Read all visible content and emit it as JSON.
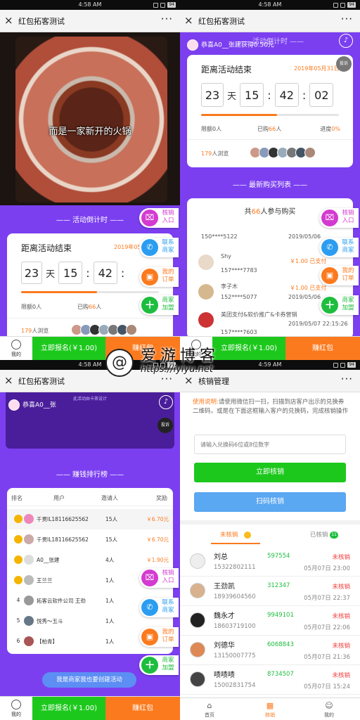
{
  "status": {
    "time1": "4:58 AM",
    "time2": "4:58 AM",
    "time3": "4:58 AM",
    "time4": "4:59 AM",
    "battery": "94"
  },
  "nav": {
    "close": "×",
    "title": "红包拓客测试",
    "more": "···",
    "title4": "核销管理"
  },
  "video": {
    "caption": "而是一家新开的火锅"
  },
  "countdown": {
    "header": "活动倒计时",
    "title": "距离活动结束",
    "date": "2019年05月31日",
    "days": "23",
    "day_unit": "天",
    "hours": "15",
    "minutes": "42",
    "seconds": "02",
    "progress": 0.55,
    "limit": "限额0人",
    "sold_prefix": "已购",
    "sold": "66",
    "sold_suffix": "人",
    "progress_label": "进度",
    "progress_val": "0%",
    "views": "179",
    "views_suffix": "人浏览",
    "tousu": "投诉",
    "date_cut": "2019年05"
  },
  "banner": {
    "congrats": "恭喜A0__张建获得0.50元",
    "congrats_cut": "恭喜A0__张",
    "slogan": "此活动由卡茶设计"
  },
  "side": [
    {
      "icon": "⌧",
      "label": "核销入口",
      "color": "#d33ad1"
    },
    {
      "icon": "✆",
      "label": "联系商家",
      "color": "#2b9df1"
    },
    {
      "icon": "▣",
      "label": "我的订单",
      "color": "#fb7a1e"
    },
    {
      "icon": "+",
      "label": "商家加盟",
      "color": "#1dbd3e"
    }
  ],
  "bottom": {
    "me": "我的",
    "signup": "立即报名(￥1.00)",
    "redpack": "赚红包",
    "redpack_cut": "赚红包"
  },
  "latest": {
    "header": "最新购买列表",
    "count_prefix": "共",
    "count": "66",
    "count_suffix": "人参与购买",
    "items": [
      {
        "name": "Shy",
        "phone": "157****7783",
        "date": "2019/05/06",
        "amount": "￥1.00 已支付"
      },
      {
        "name": "李子木",
        "phone": "152****5077",
        "date": "2019/05/06",
        "amount": "￥1.00 已支付"
      },
      {
        "name": "美团支付&软价推广&卡券营销",
        "phone": "157****7603",
        "date": "2019/05/07 22:15:26",
        "amount": "￥1.00 已支付"
      }
    ],
    "top_partial": {
      "phone": "150****5122",
      "date": "2019/05/06"
    }
  },
  "rank": {
    "header": "赚钱排行榜",
    "cols": [
      "排名",
      "用户",
      "邀请人",
      "奖励"
    ],
    "rows": [
      {
        "rank": "",
        "name": "千贯IL18116625562",
        "count": "15人",
        "reward": "￥6.70元"
      },
      {
        "rank": "",
        "name": "千贯IL18116625562",
        "count": "15人",
        "reward": "￥6.70元"
      },
      {
        "rank": "",
        "name": "A0__张建",
        "count": "4人",
        "reward": "￥1.90元"
      },
      {
        "rank": "",
        "name": "王兰兰",
        "count": "1人",
        "reward": ""
      },
      {
        "rank": "4",
        "name": "拓客云软件公司 王劲",
        "count": "1人",
        "reward": ""
      },
      {
        "rank": "5",
        "name": "悦秀～五斗",
        "count": "1人",
        "reward": ""
      },
      {
        "rank": "6",
        "name": "【柏青】",
        "count": "1人",
        "reward": ""
      }
    ],
    "create_btn": "我是商家我也要创建活动"
  },
  "verify": {
    "instr_label": "使用说明:",
    "instr": "请使用微信扫一扫，扫描到店客户出示的兑换券二维码，或是在下面这框输入客户的兑换码，完成核销操作",
    "input_placeholder": "请输入兑换码6位或8位数字",
    "btn_now": "立即核销",
    "btn_scan": "扫码核销",
    "tab_unused": "未核销",
    "tab_used": "已核销",
    "used_count": "11",
    "rows": [
      {
        "name": "刘总",
        "phone": "15322802111",
        "code": "597554",
        "status": "未核销",
        "date": "05月07日 23:00"
      },
      {
        "name": "王劲凯",
        "phone": "18939604560",
        "code": "312347",
        "status": "未核销",
        "date": "05月07日 22:37"
      },
      {
        "name": "魏永才",
        "phone": "18603719100",
        "code": "9949101",
        "status": "未核销",
        "date": "05月07日 22:06"
      },
      {
        "name": "刘德华",
        "phone": "13150007775",
        "code": "6068843",
        "status": "未核销",
        "date": "05月07日 21:36"
      },
      {
        "name": "啧啧啧",
        "phone": "15002831754",
        "code": "8734507",
        "status": "未核销",
        "date": "05月07日 15:24"
      }
    ],
    "tabbar": [
      "首页",
      "核销",
      "我的"
    ]
  },
  "watermark": {
    "line1": "爱游博客",
    "line2": "https://iyiyu.net"
  }
}
